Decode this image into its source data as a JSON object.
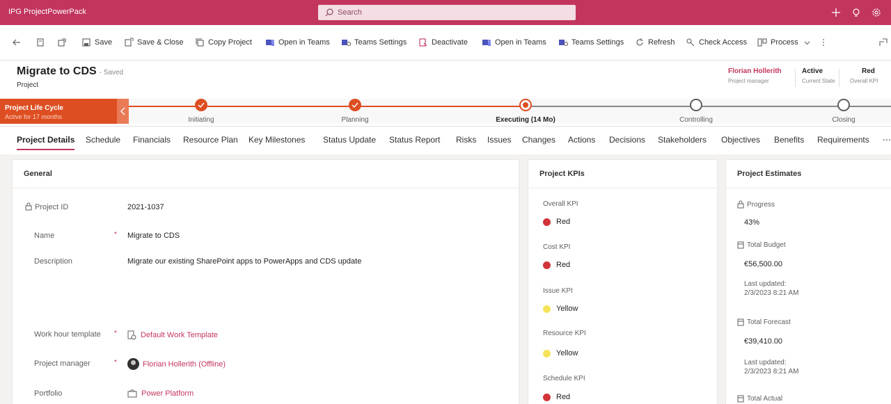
{
  "app": {
    "name": "IPG ProjectPowerPack"
  },
  "search": {
    "placeholder": "Search"
  },
  "commands": {
    "save": "Save",
    "save_close": "Save & Close",
    "copy_project": "Copy Project",
    "open_teams_1": "Open in Teams",
    "teams_settings_1": "Teams Settings",
    "deactivate": "Deactivate",
    "open_teams_2": "Open in Teams",
    "teams_settings_2": "Teams Settings",
    "refresh": "Refresh",
    "check_access": "Check Access",
    "process": "Process"
  },
  "header": {
    "title": "Migrate to CDS",
    "saved_status": "- Saved",
    "entity": "Project",
    "pm_value": "Florian Hollerith",
    "pm_label": "Project manager",
    "state_value": "Active",
    "state_label": "Current State",
    "kpi_value": "Red",
    "kpi_label": "Overall KPI"
  },
  "bpf": {
    "name": "Project Life Cycle",
    "duration": "Active for 17 months",
    "stages": [
      {
        "label": "Initiating",
        "status": "completed"
      },
      {
        "label": "Planning",
        "status": "completed"
      },
      {
        "label": "Executing (14 Mo)",
        "status": "active"
      },
      {
        "label": "Controlling",
        "status": "pending"
      },
      {
        "label": "Closing",
        "status": "pending"
      }
    ]
  },
  "tabs": [
    {
      "label": "Project Details",
      "active": true
    },
    {
      "label": "Schedule"
    },
    {
      "label": "Financials"
    },
    {
      "label": "Resource Plan"
    },
    {
      "label": "Key Milestones"
    },
    {
      "label": "Status Update"
    },
    {
      "label": "Status Report"
    },
    {
      "label": "Risks"
    },
    {
      "label": "Issues"
    },
    {
      "label": "Changes"
    },
    {
      "label": "Actions"
    },
    {
      "label": "Decisions"
    },
    {
      "label": "Stakeholders"
    },
    {
      "label": "Objectives"
    },
    {
      "label": "Benefits"
    },
    {
      "label": "Requirements"
    }
  ],
  "general": {
    "title": "General",
    "project_id_label": "Project ID",
    "project_id": "2021-1037",
    "name_label": "Name",
    "name": "Migrate to CDS",
    "description_label": "Description",
    "description": "Migrate our existing SharePoint apps to PowerApps and CDS update",
    "work_hour_label": "Work hour template",
    "work_hour": "Default Work Template",
    "pm_label": "Project manager",
    "pm": "Florian Hollerith (Offline)",
    "portfolio_label": "Portfolio",
    "portfolio": "Power Platform",
    "required_mark": "*"
  },
  "kpis": {
    "title": "Project KPIs",
    "items": [
      {
        "label": "Overall KPI",
        "value": "Red",
        "color": "#d13438"
      },
      {
        "label": "Cost KPI",
        "value": "Red",
        "color": "#d13438"
      },
      {
        "label": "Issue KPI",
        "value": "Yellow",
        "color": "#f7e35a"
      },
      {
        "label": "Resource KPI",
        "value": "Yellow",
        "color": "#f7e35a"
      },
      {
        "label": "Schedule KPI",
        "value": "Red",
        "color": "#d13438"
      }
    ]
  },
  "estimates": {
    "title": "Project Estimates",
    "progress_label": "Progress",
    "progress": "43%",
    "total_budget_label": "Total Budget",
    "total_budget": "€56,500.00",
    "budget_updated_label": "Last updated:",
    "budget_updated": "2/3/2023 8:21 AM",
    "total_forecast_label": "Total Forecast",
    "total_forecast": "€39,410.00",
    "forecast_updated_label": "Last updated:",
    "forecast_updated": "2/3/2023 8:21 AM",
    "total_actual_label": "Total Actual"
  },
  "colors": {
    "brand": "#c2365e",
    "bpf": "#dd4e22",
    "kpi_red": "#d13438",
    "kpi_yellow": "#f7e35a"
  }
}
